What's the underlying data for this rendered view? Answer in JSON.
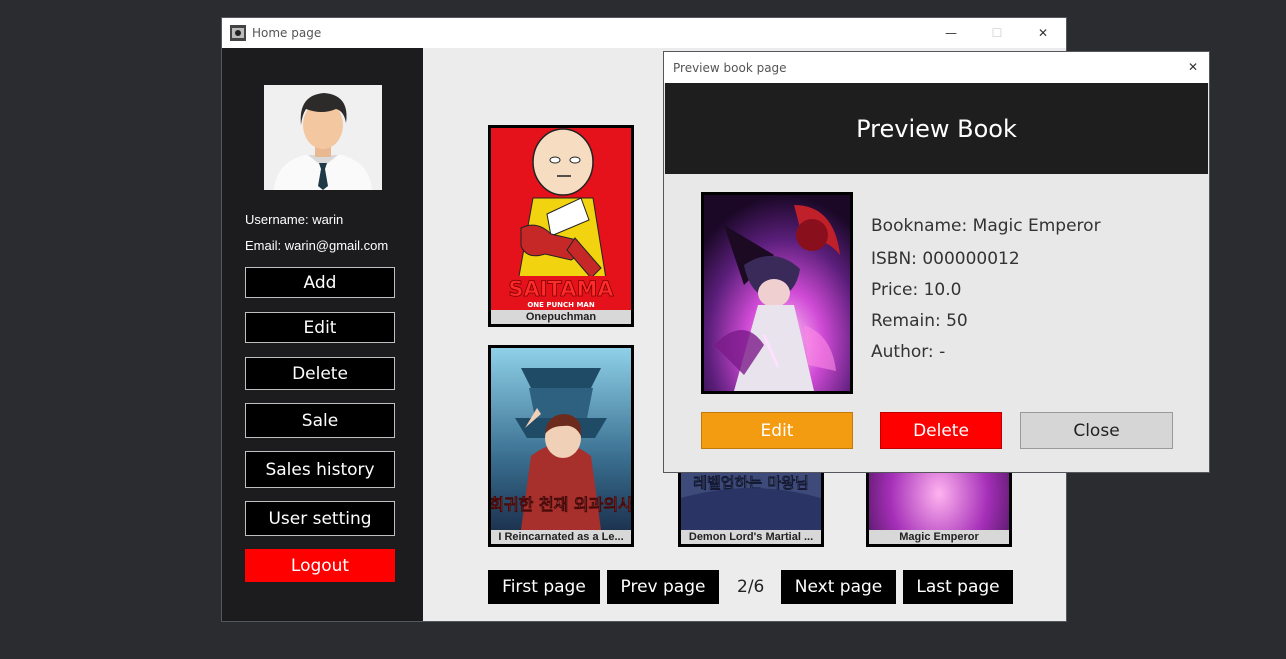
{
  "home_window": {
    "title": "Home page",
    "controls": {
      "minimize": "—",
      "maximize": "☐",
      "close": "✕"
    }
  },
  "sidebar": {
    "username": "Username: warin",
    "email": "Email: warin@gmail.com",
    "buttons": {
      "add": "Add",
      "edit": "Edit",
      "delete": "Delete",
      "sale": "Sale",
      "sales_history": "Sales history",
      "user_setting": "User setting",
      "logout": "Logout"
    }
  },
  "books": [
    {
      "name": "Onepuchman",
      "cover_text": "SAITAMA",
      "cover_sub": "ONE PUNCH MAN"
    },
    {
      "name": "I Reincarnated as a Le...",
      "cover_text": "회귀한 천재 외과의사"
    },
    {
      "name": "Demon Lord's Martial ...",
      "cover_text": "레벨업하는 마왕님"
    },
    {
      "name": "Magic Emperor"
    }
  ],
  "pagination": {
    "first": "First page",
    "prev": "Prev page",
    "indicator": "2/6",
    "next": "Next page",
    "last": "Last page"
  },
  "preview_dialog": {
    "title": "Preview book page",
    "close_glyph": "✕",
    "header": "Preview Book",
    "fields": {
      "bookname": "Bookname: Magic Emperor",
      "isbn": "ISBN: 000000012",
      "price": "Price: 10.0",
      "remain": "Remain: 50",
      "author": "Author: -"
    },
    "buttons": {
      "edit": "Edit",
      "delete": "Delete",
      "close": "Close"
    }
  },
  "colors": {
    "desktop": "#2b2c30",
    "sidebar": "#1c1c1e",
    "logout": "#ff0000",
    "edit": "#f39c12",
    "delete": "#ff0000",
    "close": "#d6d6d6"
  }
}
